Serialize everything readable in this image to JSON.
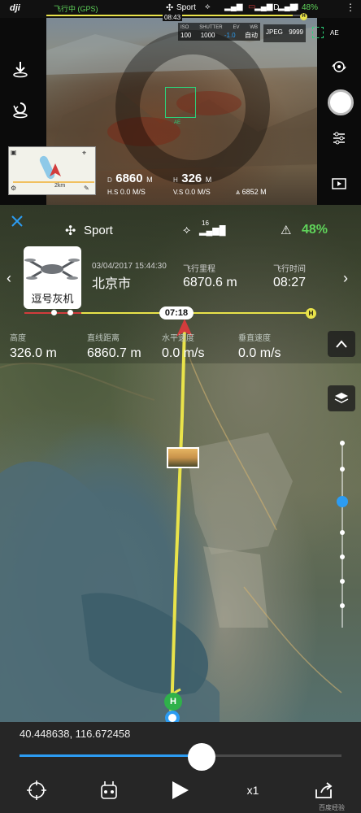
{
  "status_bar": {
    "logo": "dji",
    "flight_status": "飞行中 (GPS)",
    "mode": "Sport",
    "hd_label": "HD",
    "battery_percent": "48%",
    "flight_progress_time": "08:43",
    "flight_progress": 0.96,
    "home_label": "H"
  },
  "camera": {
    "iso_label": "ISO",
    "iso_value": "100",
    "shutter_label": "SHUTTER",
    "shutter_value": "1000",
    "ev_label": "EV",
    "ev_value": "-1.0",
    "wb_label": "WB",
    "wb_value": "自动",
    "format": "JPEG",
    "capacity": "9999",
    "ae_label": "AE",
    "focus_label": "AE",
    "minimap_scale": "2km"
  },
  "telemetry_top": {
    "distance_label": "D",
    "distance_value": "6860",
    "distance_unit": "M",
    "height_label": "H",
    "height_value": "326",
    "height_unit": "M",
    "hspeed_label": "H.S",
    "hspeed_value": "0.0",
    "speed_unit": "M/S",
    "vspeed_label": "V.S",
    "vspeed_value": "0.0",
    "altitude_value": "6852",
    "altitude_unit": "M"
  },
  "map_panel": {
    "mode": "Sport",
    "satellites": "16",
    "battery_percent": "48%",
    "drone_name": "逗号灰机",
    "date_time": "03/04/2017 15:44:30",
    "location": "北京市",
    "mileage_label": "飞行里程",
    "mileage_value": "6870.6 m",
    "duration_label": "飞行时间",
    "duration_value": "08:27",
    "timeline_time": "07:18",
    "timeline_home": "H"
  },
  "stats": [
    {
      "label": "高度",
      "value": "326.0 m"
    },
    {
      "label": "直线距离",
      "value": "6860.7 m"
    },
    {
      "label": "水平速度",
      "value": "0.0 m/s"
    },
    {
      "label": "垂直速度",
      "value": "0.0 m/s"
    }
  ],
  "map_markers": {
    "home_label": "H"
  },
  "playback": {
    "coordinates": "40.448638, 116.672458",
    "progress": 0.58,
    "speed": "x1"
  },
  "watermark": "百度经验",
  "colors": {
    "accent_blue": "#2c9cf2",
    "battery_green": "#5fd35a",
    "path_yellow": "#e9e34a",
    "home_green": "#2fb14a",
    "focus_green": "#2cd27a"
  }
}
